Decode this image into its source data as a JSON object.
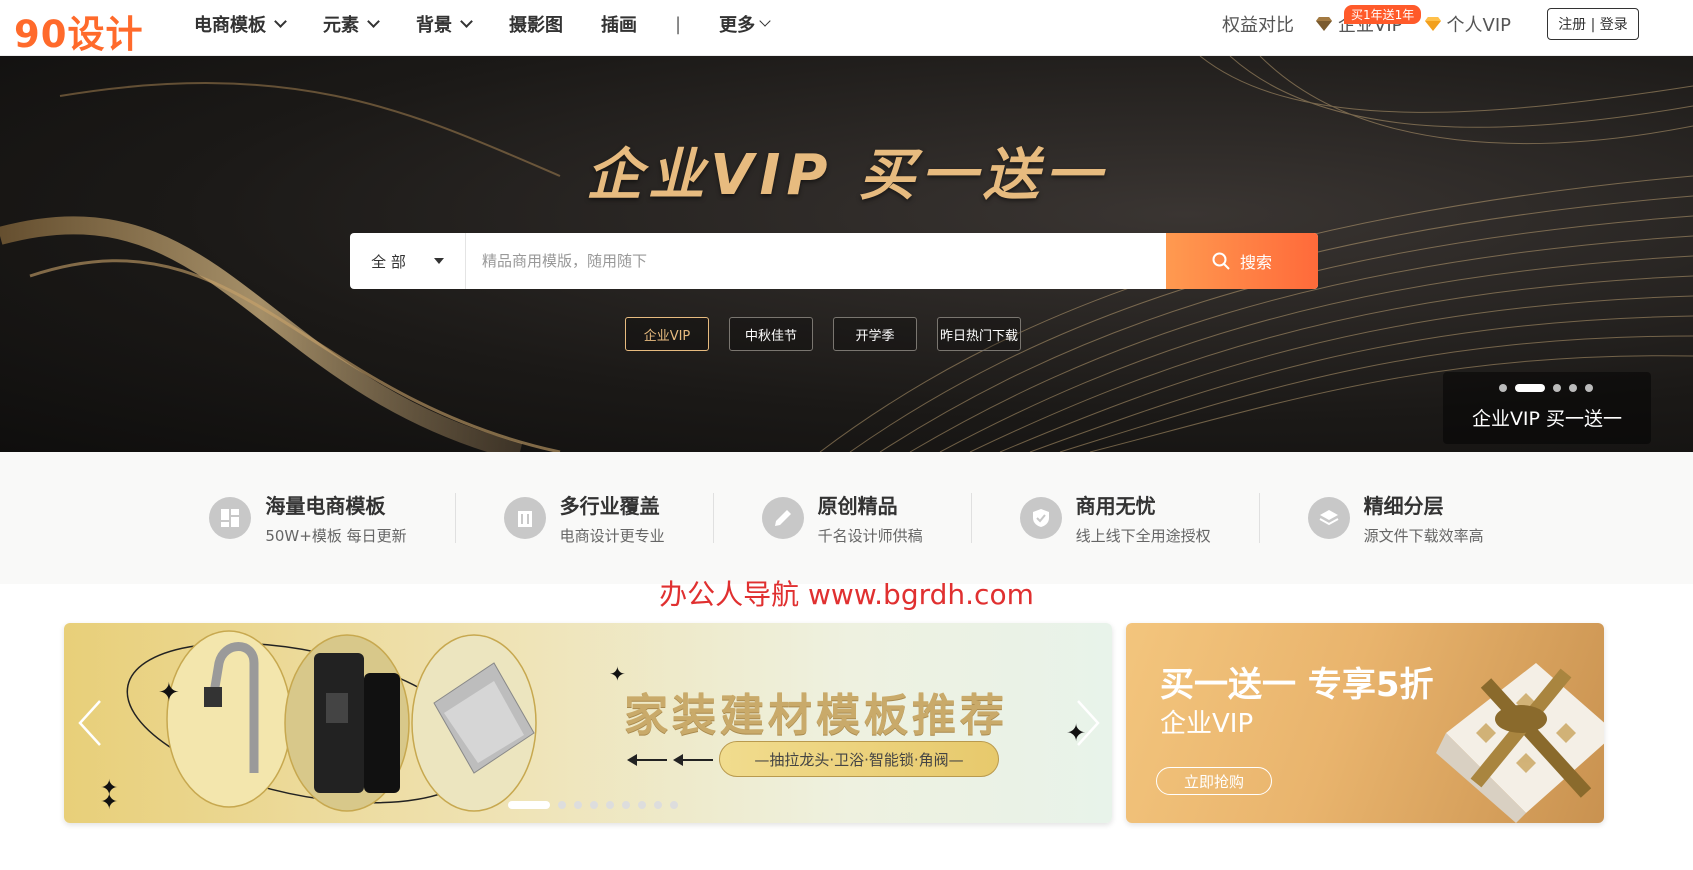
{
  "header": {
    "logo": "90设计",
    "nav": [
      {
        "label": "电商模板",
        "has_dropdown": true
      },
      {
        "label": "元素",
        "has_dropdown": true
      },
      {
        "label": "背景",
        "has_dropdown": true
      },
      {
        "label": "摄影图",
        "has_dropdown": false
      },
      {
        "label": "插画",
        "has_dropdown": false
      }
    ],
    "separator": "|",
    "more": "更多",
    "compare": "权益对比",
    "enterprise_vip": "企业VIP",
    "enterprise_badge": "买1年送1年",
    "personal_vip": "个人VIP",
    "login": "注册 | 登录"
  },
  "hero": {
    "title": "企业VIP 买一送一",
    "search": {
      "category": "全 部",
      "placeholder": "精品商用模版，随用随下",
      "button": "搜索"
    },
    "tags": [
      "企业VIP",
      "中秋佳节",
      "开学季",
      "昨日热门下载"
    ],
    "caption": "企业VIP 买一送一",
    "slide_count": 5,
    "active_slide": 2
  },
  "features": [
    {
      "title": "海量电商模板",
      "sub": "50W+模板 每日更新",
      "icon": "layout-icon"
    },
    {
      "title": "多行业覆盖",
      "sub": "电商设计更专业",
      "icon": "building-icon"
    },
    {
      "title": "原创精品",
      "sub": "千名设计师供稿",
      "icon": "pen-icon"
    },
    {
      "title": "商用无忧",
      "sub": "线上线下全用途授权",
      "icon": "shield-icon"
    },
    {
      "title": "精细分层",
      "sub": "源文件下载效率高",
      "icon": "layers-icon"
    }
  ],
  "watermark": "办公人导航 www.bgrdh.com",
  "banner_main": {
    "title": "家装建材模板推荐",
    "subtitle": "—抽拉龙头·卫浴·智能锁·角阀—",
    "dot_count": 9
  },
  "banner_side": {
    "title": "买一送一 专享5折",
    "sub": "企业VIP",
    "button": "立即抢购"
  },
  "colors": {
    "brand": "#ff6a2b",
    "gold": "#e7bb7f",
    "search_button": "#ff7a40",
    "watermark": "#e03030"
  }
}
